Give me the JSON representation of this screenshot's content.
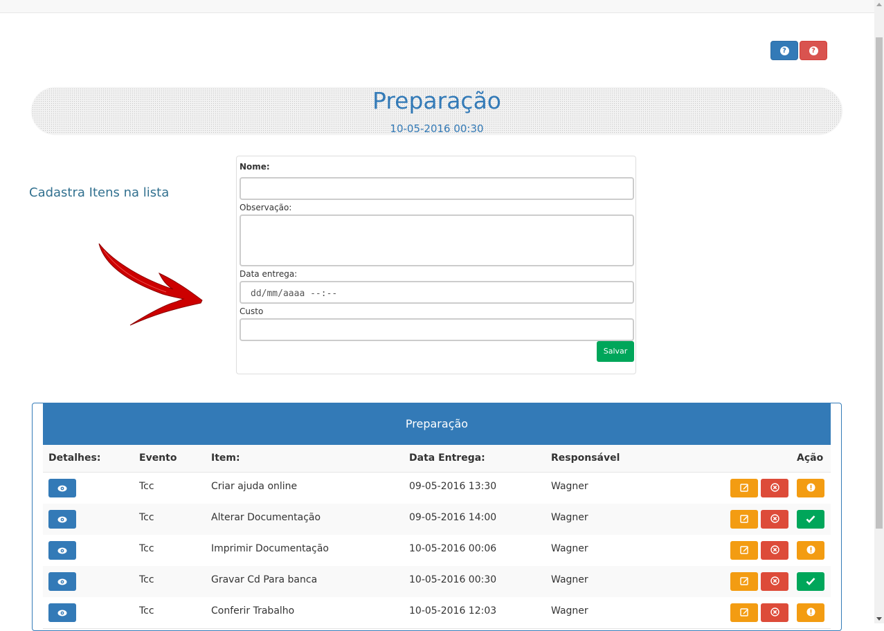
{
  "help_buttons": [
    {
      "icon": "question-circle-icon",
      "color": "#337ab7"
    },
    {
      "icon": "question-circle-icon",
      "color": "#d9534f"
    }
  ],
  "banner": {
    "title": "Preparação",
    "date": "10-05-2016 00:30"
  },
  "side": {
    "title": "Cadastra Itens na lista",
    "arrow_icon": "red-arrow-icon"
  },
  "form": {
    "nome_label": "Nome:",
    "obs_label": "Observação:",
    "data_label": "Data entrega:",
    "data_placeholder": "dd/mm/aaaa --:--",
    "custo_label": "Custo",
    "save_label": "Salvar"
  },
  "table": {
    "title": "Preparação",
    "headers": [
      "Detalhes:",
      "Evento",
      "Item:",
      "Data Entrega:",
      "Responsável",
      "Ação"
    ],
    "rows": [
      {
        "evento": "Tcc",
        "item": "Criar ajuda online",
        "data": "09-05-2016 13:30",
        "responsavel": "Wagner",
        "status": "pending"
      },
      {
        "evento": "Tcc",
        "item": "Alterar Documentação",
        "data": "09-05-2016 14:00",
        "responsavel": "Wagner",
        "status": "done"
      },
      {
        "evento": "Tcc",
        "item": "Imprimir Documentação",
        "data": "10-05-2016 00:06",
        "responsavel": "Wagner",
        "status": "pending"
      },
      {
        "evento": "Tcc",
        "item": "Gravar Cd Para banca",
        "data": "10-05-2016 00:30",
        "responsavel": "Wagner",
        "status": "done"
      },
      {
        "evento": "Tcc",
        "item": "Conferir Trabalho",
        "data": "10-05-2016 12:03",
        "responsavel": "Wagner",
        "status": "pending"
      }
    ]
  },
  "colors": {
    "primary": "#337ab7",
    "danger": "#dd4b39",
    "warning": "#f39c12",
    "success": "#00a65a"
  }
}
